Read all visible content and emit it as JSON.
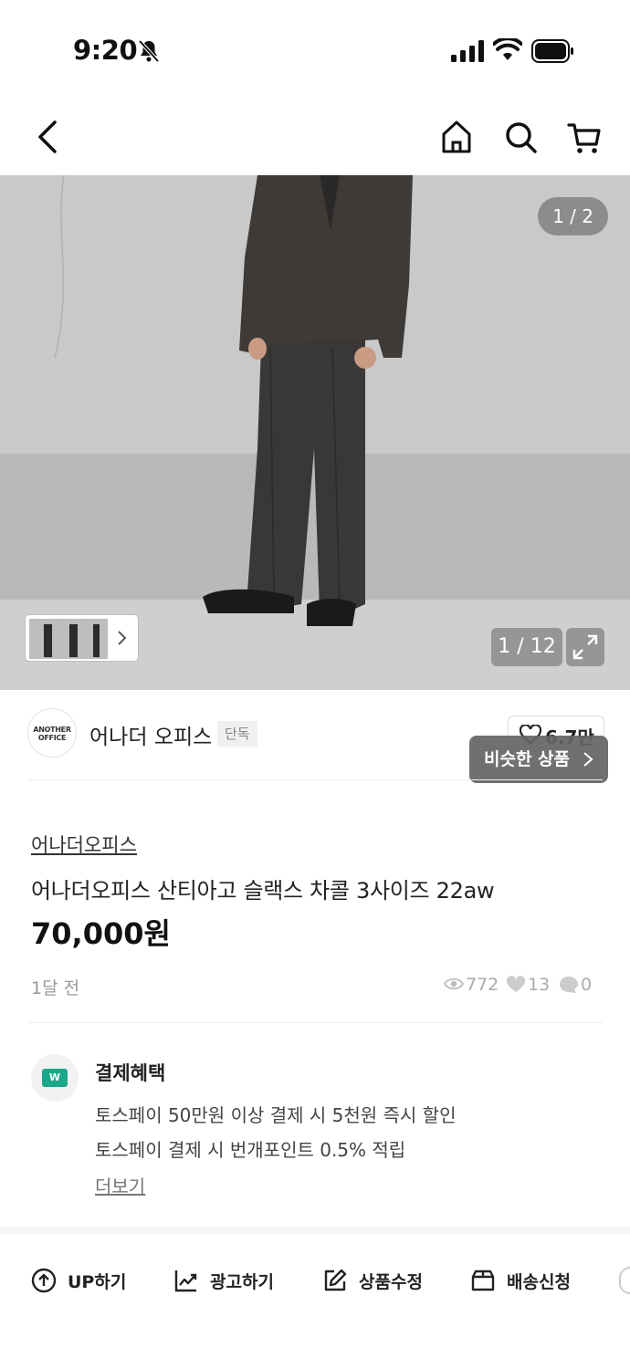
{
  "status_bar": {
    "time": "9:20"
  },
  "gallery": {
    "page_indicator": "1 / 2",
    "image_count": "1 / 12"
  },
  "shop": {
    "logo_text": "ANOTHER OFFICE",
    "name": "어나더 오피스",
    "badge": "단독",
    "likes": "6.7만",
    "similar_button": "비슷한 상품"
  },
  "product": {
    "brand": "어나더오피스",
    "title": "어나더오피스 산티아고 슬랙스 차콜 3사이즈 22aw",
    "price": "70,000원",
    "posted": "1달 전",
    "views": "772",
    "likes": "13",
    "comments": "0"
  },
  "payment": {
    "icon_text": "W",
    "title": "결제혜택",
    "lines": [
      "토스페이 50만원 이상 결제 시 5천원 즉시 할인",
      "토스페이 결제 시 번개포인트 0.5% 적립"
    ],
    "more": "더보기"
  },
  "actions": [
    {
      "label": "UP하기",
      "icon": "arrow-up-circle-icon"
    },
    {
      "label": "광고하기",
      "icon": "trend-chart-icon"
    },
    {
      "label": "상품수정",
      "icon": "edit-icon"
    },
    {
      "label": "배송신청",
      "icon": "box-icon"
    }
  ]
}
